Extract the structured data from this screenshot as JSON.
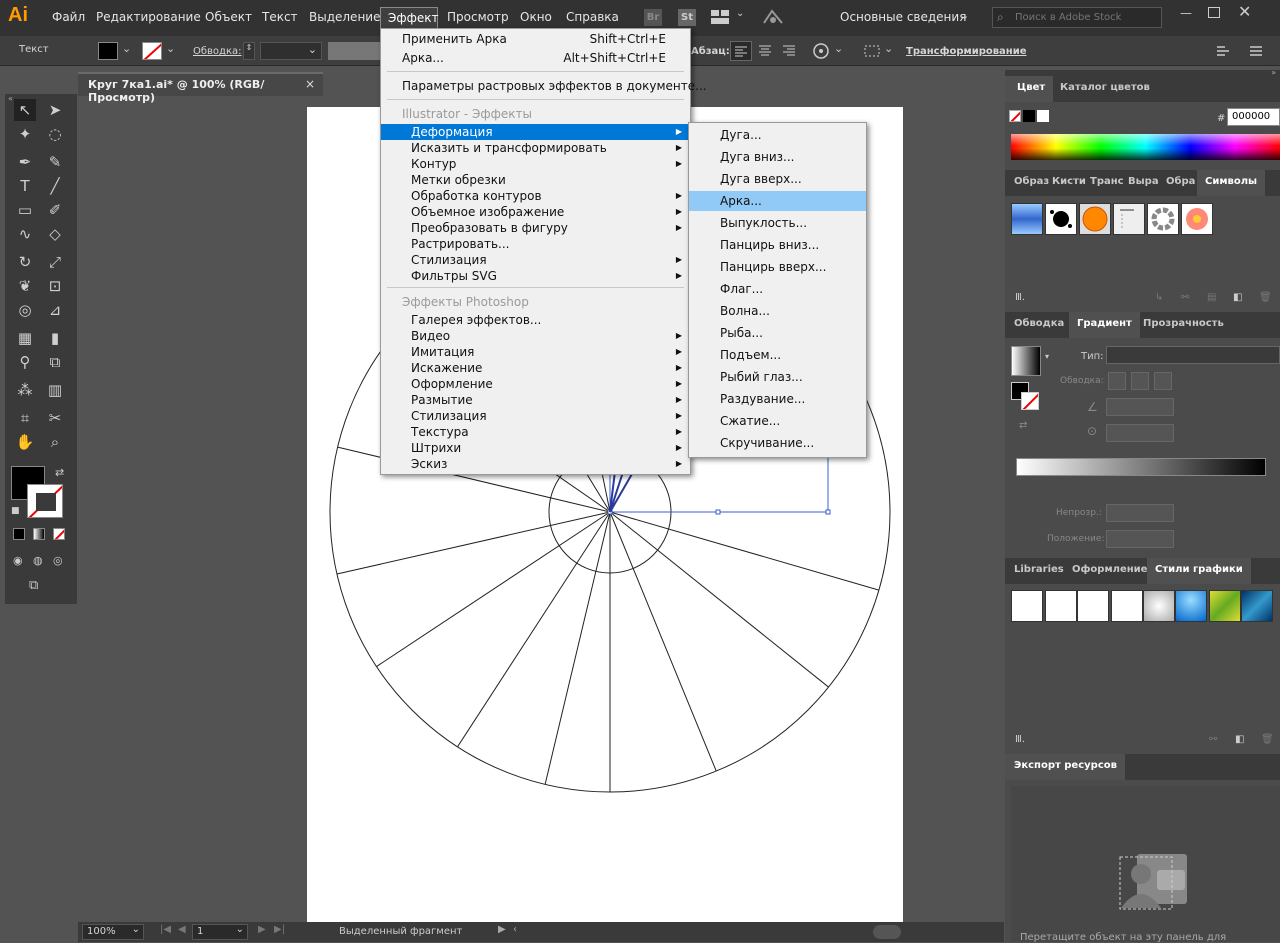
{
  "app": {
    "logo": "Ai",
    "document_tab": "Круг 7ка1.ai* @ 100% (RGB/Просмотр)",
    "close": "×"
  },
  "menubar": {
    "items": [
      "Файл",
      "Редактирование",
      "Объект",
      "Текст",
      "Выделение",
      "Эффект",
      "Просмотр",
      "Окно",
      "Справка"
    ],
    "br": "Br",
    "st": "St",
    "workspace": "Основные сведения",
    "search_placeholder": "Поиск в Adobe Stock"
  },
  "controlbar": {
    "label": "Текст",
    "stroke": "Обводка:",
    "paragraph": "Абзац:",
    "transform": "Трансформирование"
  },
  "effect_menu": {
    "apply": "Применить Арка",
    "apply_shortcut": "Shift+Ctrl+E",
    "arc": "Арка...",
    "arc_shortcut": "Alt+Shift+Ctrl+E",
    "raster": "Параметры растровых эффектов в документе...",
    "illustrator_header": "Illustrator - Эффекты",
    "illustrator_items": [
      {
        "label": "Деформация",
        "sub": true
      },
      {
        "label": "Исказить и трансформировать",
        "sub": true
      },
      {
        "label": "Контур",
        "sub": true
      },
      {
        "label": "Метки обрезки",
        "sub": false
      },
      {
        "label": "Обработка контуров",
        "sub": true
      },
      {
        "label": "Объемное изображение",
        "sub": true
      },
      {
        "label": "Преобразовать в фигуру",
        "sub": true
      },
      {
        "label": "Растрировать...",
        "sub": false
      },
      {
        "label": "Стилизация",
        "sub": true
      },
      {
        "label": "Фильтры SVG",
        "sub": true
      }
    ],
    "photoshop_header": "Эффекты Photoshop",
    "photoshop_items": [
      {
        "label": "Галерея эффектов...",
        "sub": false
      },
      {
        "label": "Видео",
        "sub": true
      },
      {
        "label": "Имитация",
        "sub": true
      },
      {
        "label": "Искажение",
        "sub": true
      },
      {
        "label": "Оформление",
        "sub": true
      },
      {
        "label": "Размытие",
        "sub": true
      },
      {
        "label": "Стилизация",
        "sub": true
      },
      {
        "label": "Текстура",
        "sub": true
      },
      {
        "label": "Штрихи",
        "sub": true
      },
      {
        "label": "Эскиз",
        "sub": true
      }
    ]
  },
  "warp_submenu": [
    "Дуга...",
    "Дуга вниз...",
    "Дуга вверх...",
    "Арка...",
    "Выпуклость...",
    "Панцирь вниз...",
    "Панцирь вверх...",
    "Флаг...",
    "Волна...",
    "Рыба...",
    "Подъем...",
    "Рыбий глаз...",
    "Раздувание...",
    "Сжатие...",
    "Скручивание..."
  ],
  "warp_selected": "Арка...",
  "color_panel": {
    "tabs": [
      "Цвет",
      "Каталог цветов"
    ],
    "hash": "#",
    "hex": "000000"
  },
  "symbols_panel": {
    "tabs": [
      "Образ",
      "Кисти",
      "Транс",
      "Выра",
      "Обра",
      "Символы"
    ]
  },
  "gradient_panel": {
    "tabs": [
      "Обводка",
      "Градиент",
      "Прозрачность"
    ],
    "type_label": "Тип:",
    "stroke_label": "Обводка:",
    "opacity_label": "Непрозр.:",
    "location_label": "Положение:"
  },
  "styles_panel": {
    "tabs": [
      "Libraries",
      "Оформление",
      "Стили графики"
    ]
  },
  "export_panel": {
    "title": "Экспорт ресурсов",
    "hint": "Перетащите объект на эту панель для"
  },
  "statusbar": {
    "zoom": "100%",
    "page": "1",
    "status": "Выделенный фрагмент"
  },
  "colors": {
    "accent": "#0078d7",
    "submenu_selected": "#91c9f7",
    "ui_bg": "#535353"
  }
}
